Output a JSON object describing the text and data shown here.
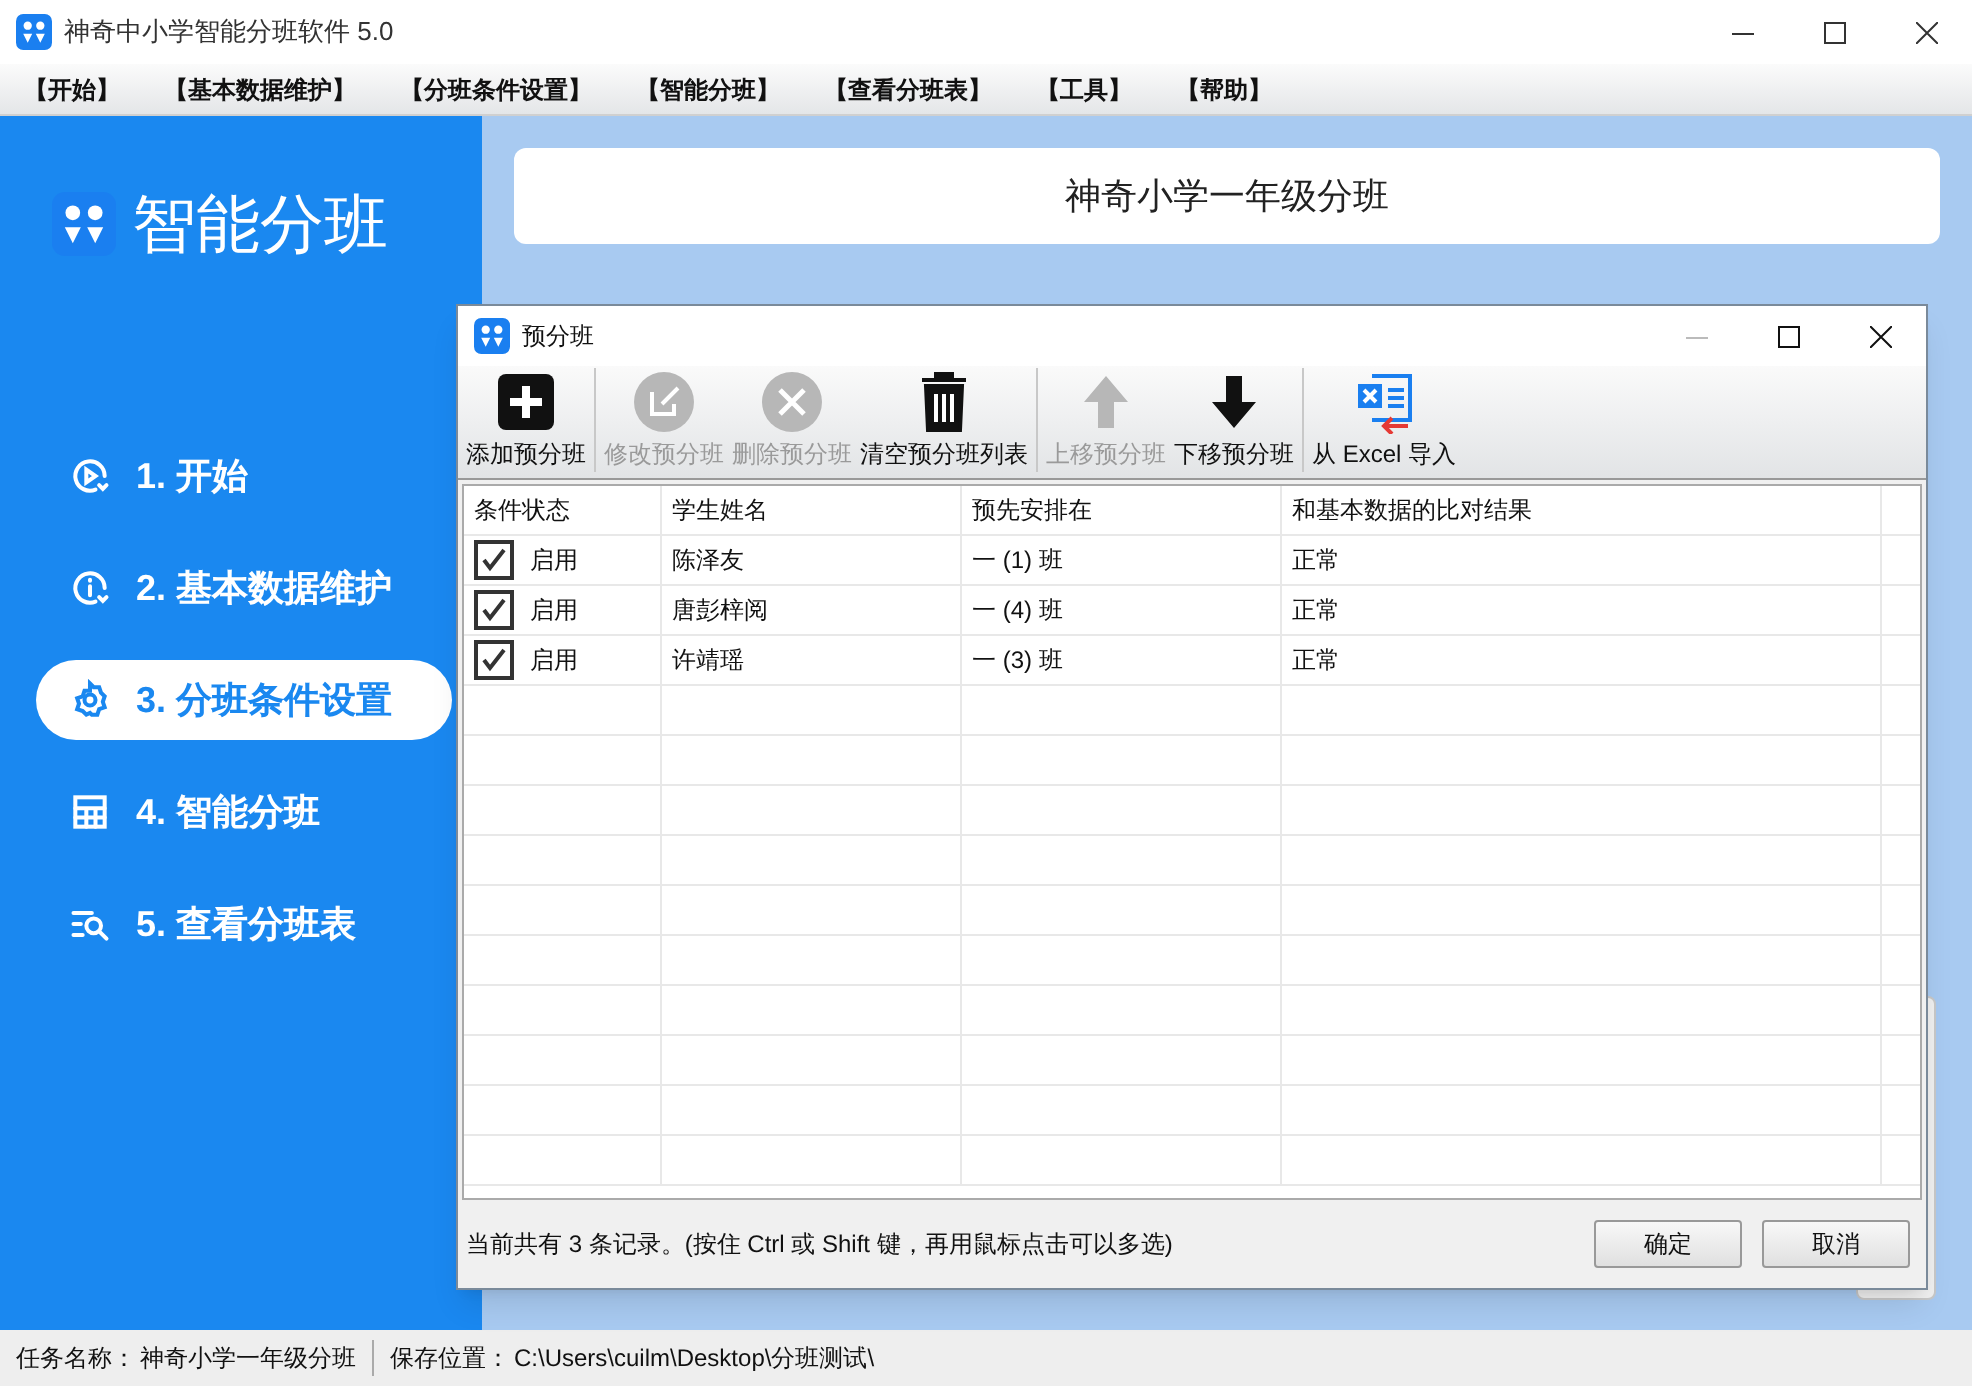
{
  "window": {
    "title": "神奇中小学智能分班软件 5.0"
  },
  "menu": [
    "【开始】",
    "【基本数据维护】",
    "【分班条件设置】",
    "【智能分班】",
    "【查看分班表】",
    "【工具】",
    "【帮助】"
  ],
  "sidebar": {
    "title": "智能分班",
    "items": [
      {
        "label": "1. 开始",
        "selected": false
      },
      {
        "label": "2. 基本数据维护",
        "selected": false
      },
      {
        "label": "3. 分班条件设置",
        "selected": true
      },
      {
        "label": "4. 智能分班",
        "selected": false
      },
      {
        "label": "5. 查看分班表",
        "selected": false
      }
    ]
  },
  "header": {
    "title": "神奇小学一年级分班"
  },
  "dialog": {
    "title": "预分班",
    "toolbar": [
      {
        "items": [
          {
            "label": "添加预分班",
            "disabled": false
          }
        ]
      },
      {
        "items": [
          {
            "label": "修改预分班",
            "disabled": true
          },
          {
            "label": "删除预分班",
            "disabled": true
          },
          {
            "label": "清空预分班列表",
            "disabled": false
          }
        ]
      },
      {
        "items": [
          {
            "label": "上移预分班",
            "disabled": true
          },
          {
            "label": "下移预分班",
            "disabled": false
          }
        ]
      },
      {
        "items": [
          {
            "label": "从 Excel 导入",
            "disabled": false
          }
        ]
      }
    ],
    "columns": [
      "条件状态",
      "学生姓名",
      "预先安排在",
      "和基本数据的比对结果"
    ],
    "rows": [
      {
        "checked": true,
        "status": "启用",
        "name": "陈泽友",
        "class": "一 (1) 班",
        "result": "正常"
      },
      {
        "checked": true,
        "status": "启用",
        "name": "唐彭梓阅",
        "class": "一 (4) 班",
        "result": "正常"
      },
      {
        "checked": true,
        "status": "启用",
        "name": "许靖瑶",
        "class": "一 (3) 班",
        "result": "正常"
      }
    ],
    "footer": "当前共有 3 条记录。(按住 Ctrl 或 Shift 键，再用鼠标点击可以多选)",
    "buttons": [
      "确定",
      "取消"
    ]
  },
  "status_bar": {
    "task_label": "任务名称：",
    "task": "神奇小学一年级分班",
    "path_label": "保存位置：",
    "path": "C:\\Users\\cuilm\\Desktop\\分班测试\\"
  }
}
